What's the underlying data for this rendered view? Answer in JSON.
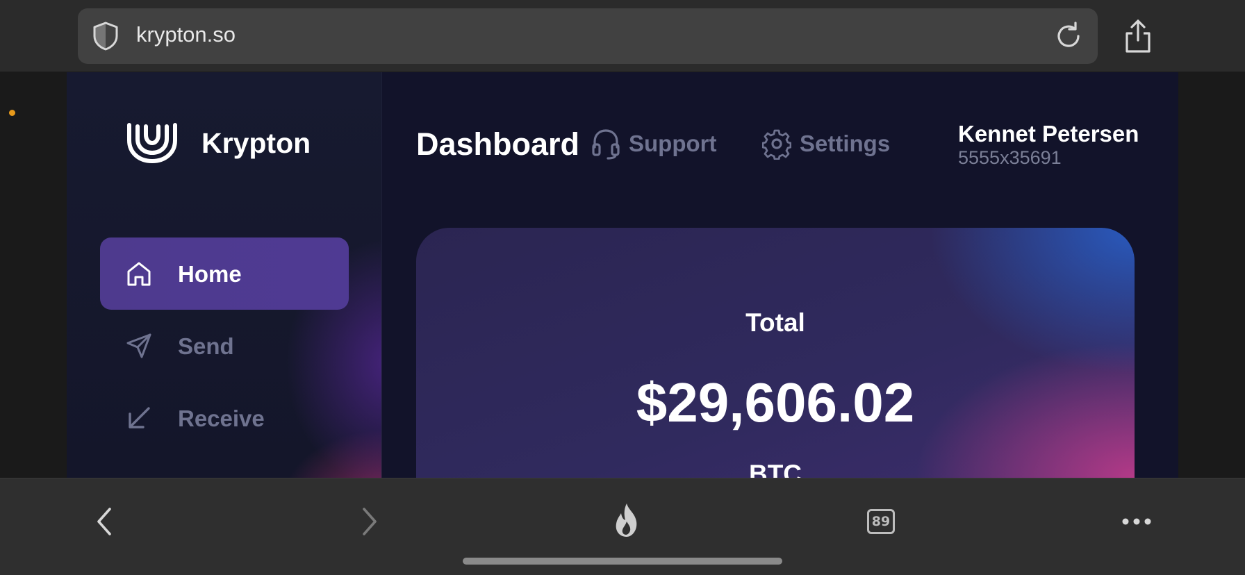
{
  "browser": {
    "url": "krypton.so",
    "icons": [
      "shield-icon",
      "reload-icon",
      "share-icon"
    ]
  },
  "sidebar": {
    "brand": "Krypton",
    "items": [
      {
        "label": "Home",
        "icon": "home-icon",
        "active": true
      },
      {
        "label": "Send",
        "icon": "send-icon",
        "active": false
      },
      {
        "label": "Receive",
        "icon": "receive-arrow-icon",
        "active": false
      }
    ]
  },
  "header": {
    "title": "Dashboard",
    "support_label": "Support",
    "settings_label": "Settings",
    "user_name": "Kennet Petersen",
    "user_id": "5555x35691"
  },
  "balance_card": {
    "label": "Total",
    "value": "$29,606.02",
    "currency": "BTC"
  },
  "toolbar": {
    "tabs_count": "89",
    "icons": [
      "back-icon",
      "forward-icon",
      "fire-icon",
      "tabs-icon",
      "more-icon"
    ]
  },
  "colors": {
    "app_bg": "#12132a",
    "active_nav": "#4f3a93",
    "muted_text": "#6f7390",
    "accent_dot": "#e89a1b"
  }
}
